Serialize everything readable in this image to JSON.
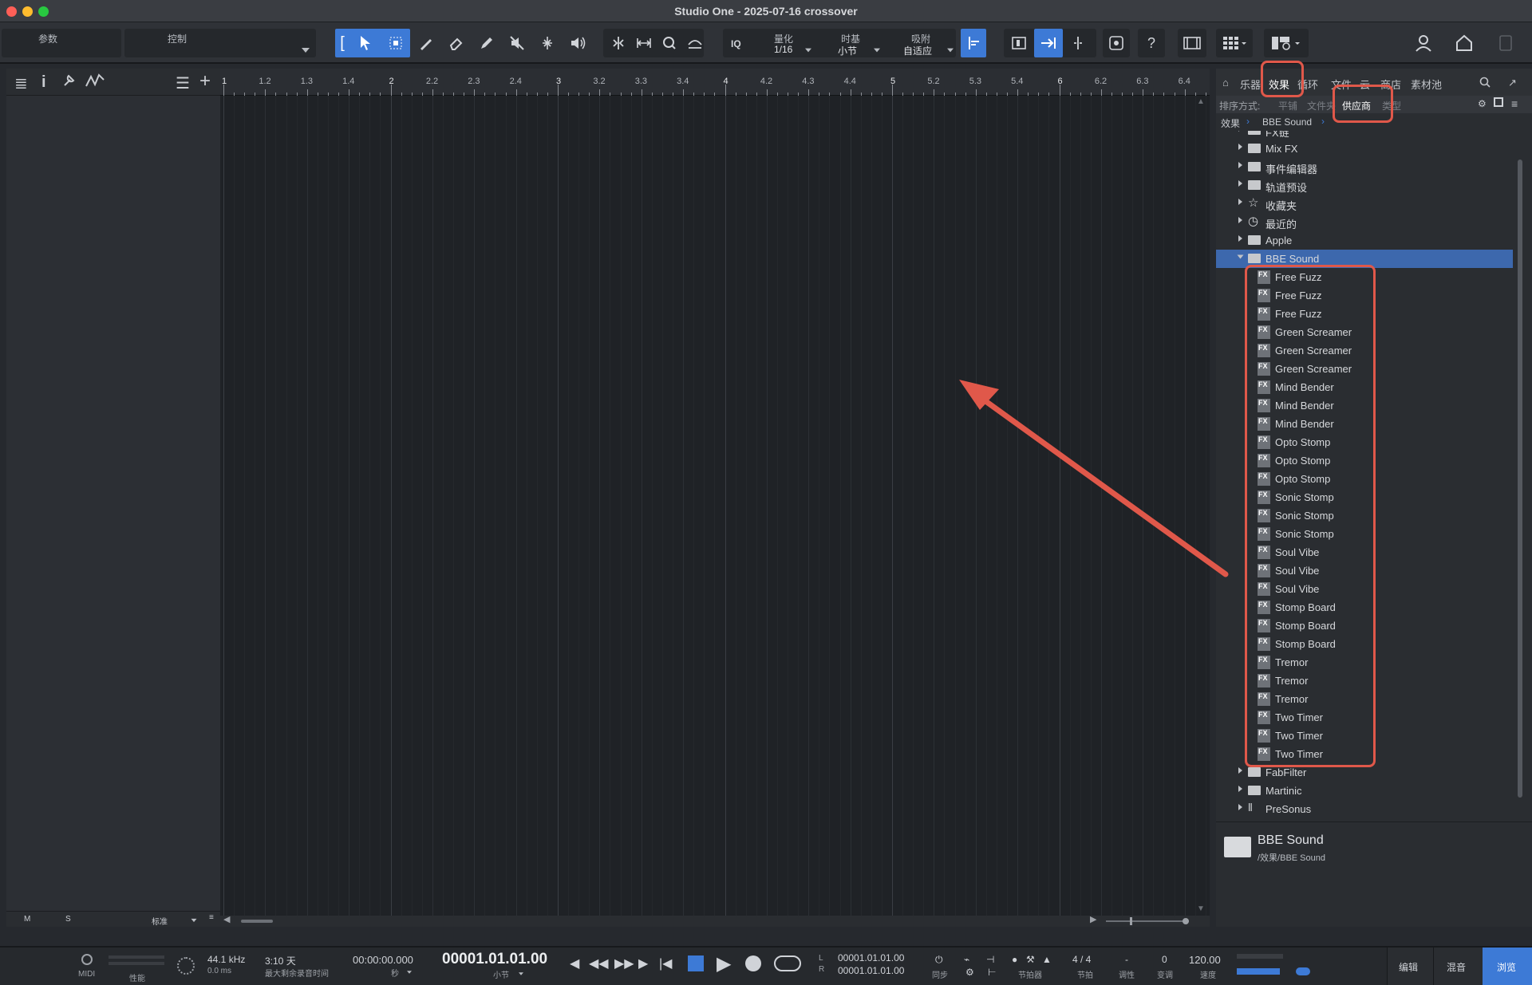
{
  "window": {
    "title": "Studio One - 2025-07-16 crossover"
  },
  "toolbar": {
    "param_label": "参数",
    "control_label": "控制",
    "quantize": {
      "label": "量化",
      "value": "1/16"
    },
    "timebase": {
      "label": "时基",
      "value": "小节"
    },
    "snap": {
      "label": "吸附",
      "value": "自适应"
    },
    "iq_label": "IQ",
    "help_label": "?"
  },
  "left_panel": {
    "footer_m": "M",
    "footer_s": "S",
    "footer_mode": "标准"
  },
  "ruler": {
    "ticks": [
      "1",
      "1.2",
      "1.3",
      "1.4",
      "2",
      "2.2",
      "2.3",
      "2.4",
      "3",
      "3.2",
      "3.3",
      "3.4",
      "4",
      "4.2",
      "4.3",
      "4.4",
      "5",
      "5.2",
      "5.3",
      "5.4",
      "6",
      "6.2",
      "6.3",
      "6.4"
    ]
  },
  "browser": {
    "tabs": [
      "乐器",
      "效果",
      "循环",
      "文件",
      "云",
      "商店",
      "素材池"
    ],
    "sort_label": "排序方式:",
    "sort_options": [
      "平铺",
      "文件夹",
      "供应商",
      "类型"
    ],
    "breadcrumb": [
      "效果",
      "BBE Sound"
    ],
    "tree_top": [
      {
        "label": "FX链",
        "icon": "folder"
      },
      {
        "label": "Mix FX",
        "icon": "folder"
      },
      {
        "label": "事件编辑器",
        "icon": "folder"
      },
      {
        "label": "轨道预设",
        "icon": "folder"
      },
      {
        "label": "收藏夹",
        "icon": "star"
      },
      {
        "label": "最近的",
        "icon": "clock"
      },
      {
        "label": "Apple",
        "icon": "folder"
      },
      {
        "label": "BBE Sound",
        "icon": "folder-open"
      }
    ],
    "bbe_items": [
      "Free Fuzz",
      "Free Fuzz",
      "Free Fuzz",
      "Green Screamer",
      "Green Screamer",
      "Green Screamer",
      "Mind Bender",
      "Mind Bender",
      "Mind Bender",
      "Opto Stomp",
      "Opto Stomp",
      "Opto Stomp",
      "Sonic Stomp",
      "Sonic Stomp",
      "Sonic Stomp",
      "Soul Vibe",
      "Soul Vibe",
      "Soul Vibe",
      "Stomp Board",
      "Stomp Board",
      "Stomp Board",
      "Tremor",
      "Tremor",
      "Tremor",
      "Two Timer",
      "Two Timer",
      "Two Timer"
    ],
    "fx_badge": "FX",
    "tree_bottom": [
      {
        "label": "FabFilter",
        "icon": "folder"
      },
      {
        "label": "Martinic",
        "icon": "folder"
      },
      {
        "label": "PreSonus",
        "icon": "presonus"
      }
    ],
    "info": {
      "name": "BBE Sound",
      "path": "/效果/BBE Sound"
    }
  },
  "transport": {
    "midi_label": "MIDI",
    "perf_label": "性能",
    "sample_rate": "44.1 kHz",
    "latency": "0.0 ms",
    "record_time": "3:10 天",
    "record_time_label": "最大剩余录音时间",
    "time_seconds": "00:00:00.000",
    "time_seconds_unit": "秒",
    "position_bars": "00001.01.01.00",
    "position_bars_unit": "小节",
    "loop_l_label": "L",
    "loop_r_label": "R",
    "loop_start": "00001.01.01.00",
    "loop_end": "00001.01.01.00",
    "sync_label": "同步",
    "metronome_label": "节拍器",
    "signature": "4 / 4",
    "signature_label": "节拍",
    "key": "-",
    "key_label": "调性",
    "transpose": "0",
    "transpose_label": "变调",
    "tempo": "120.00",
    "tempo_label": "速度",
    "edit_label": "编辑",
    "mix_label": "混音",
    "browse_label": "浏览"
  },
  "colors": {
    "accent": "#3d7ad6",
    "highlight": "#e0584a",
    "selection": "#3d68ad"
  }
}
